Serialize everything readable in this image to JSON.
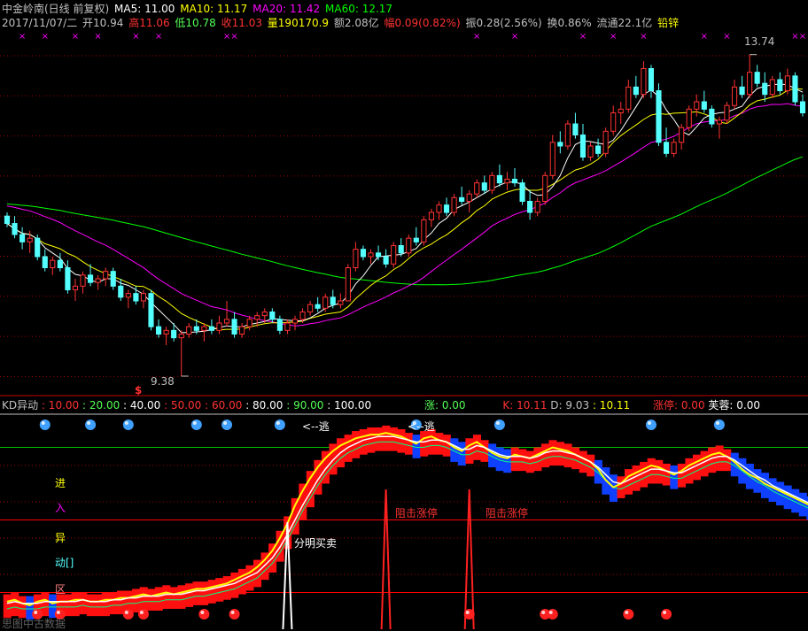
{
  "header": {
    "title": "中金岭南(日线 前复权)",
    "ma5_label": "MA5: 11.00",
    "ma10_label": "MA10: 11.17",
    "ma20_label": "MA20: 11.42",
    "ma60_label": "MA60: 12.17",
    "date": "2017/11/07/二",
    "open": "开10.94",
    "high": "高11.06",
    "low": "低10.78",
    "close": "收11.03",
    "volume": "量190170.9",
    "amount": "额2.08亿",
    "change": "幅0.09(0.82%)",
    "amplitude": "振0.28(2.56%)",
    "turnover": "换0.86%",
    "float": "流通22.1亿",
    "industry": "铅锌"
  },
  "indicator_header": {
    "name": "KD异动",
    "l10": ": 10.00",
    "l20": ": 20.00",
    "l40": ": 40.00",
    "l50": ": 50.00",
    "l60": ": 60.00",
    "l80": ": 80.00",
    "l90": ": 90.00",
    "l100": ": 100.00",
    "zhang": "涨: 0.00",
    "k": "K: 10.11",
    "d": "D: 9.03",
    "v": ": 10.11",
    "limit_up": "涨停: 0.00",
    "furong": "芙蓉: 0.00"
  },
  "annotations": {
    "high_label": "13.74",
    "low_label": "9.38",
    "escape1": "<--逃",
    "escape2": "<--逃",
    "resist1": "阻击涨停",
    "resist2": "阻击涨停",
    "trade": "分明买卖",
    "side_jin": "进",
    "side_ru": "入",
    "side_yi": "异",
    "side_dong": "动[]",
    "side_qu": "区",
    "dollar": "$",
    "footer": "思图中古数据"
  },
  "colors": {
    "up": "#ff3232",
    "down": "#54ffff",
    "ma5": "#ffffff",
    "ma10": "#ffff00",
    "ma20": "#ff00ff",
    "ma60": "#00ff00",
    "grid": "#a00000",
    "k_line": "#ffff00",
    "d_line": "#ffffff"
  },
  "chart_data": [
    {
      "type": "candlestick",
      "title": "中金岭南(日线 前复权)",
      "ylim": [
        9.2,
        14.0
      ],
      "annotations": {
        "max": 13.74,
        "min": 9.38
      },
      "candles": [
        [
          11.55,
          11.6,
          11.4,
          11.45
        ],
        [
          11.45,
          11.55,
          11.25,
          11.3
        ],
        [
          11.3,
          11.4,
          11.1,
          11.2
        ],
        [
          11.2,
          11.35,
          11.05,
          11.25
        ],
        [
          11.25,
          11.3,
          10.95,
          11.0
        ],
        [
          11.0,
          11.1,
          10.8,
          10.85
        ],
        [
          10.85,
          11.0,
          10.75,
          10.95
        ],
        [
          10.95,
          11.05,
          10.8,
          10.85
        ],
        [
          10.85,
          10.95,
          10.5,
          10.55
        ],
        [
          10.55,
          10.7,
          10.4,
          10.6
        ],
        [
          10.6,
          10.8,
          10.5,
          10.75
        ],
        [
          10.75,
          10.9,
          10.6,
          10.65
        ],
        [
          10.65,
          10.75,
          10.55,
          10.7
        ],
        [
          10.7,
          10.85,
          10.6,
          10.8
        ],
        [
          10.8,
          10.85,
          10.55,
          10.6
        ],
        [
          10.6,
          10.7,
          10.4,
          10.45
        ],
        [
          10.45,
          10.55,
          10.3,
          10.5
        ],
        [
          10.5,
          10.6,
          10.35,
          10.4
        ],
        [
          10.4,
          10.55,
          10.3,
          10.5
        ],
        [
          10.5,
          10.55,
          10.0,
          10.05
        ],
        [
          10.05,
          10.15,
          9.9,
          9.95
        ],
        [
          9.95,
          10.05,
          9.8,
          10.0
        ],
        [
          10.0,
          10.1,
          9.85,
          9.9
        ],
        [
          9.9,
          10.0,
          9.38,
          9.95
        ],
        [
          9.95,
          10.1,
          9.9,
          10.05
        ],
        [
          10.05,
          10.15,
          9.95,
          10.0
        ],
        [
          10.0,
          10.1,
          9.85,
          10.05
        ],
        [
          10.05,
          10.15,
          9.95,
          10.0
        ],
        [
          10.0,
          10.2,
          9.95,
          10.1
        ],
        [
          10.1,
          10.4,
          10.05,
          10.15
        ],
        [
          10.15,
          10.25,
          9.9,
          9.95
        ],
        [
          9.95,
          10.1,
          9.9,
          10.05
        ],
        [
          10.05,
          10.2,
          10.0,
          10.15
        ],
        [
          10.15,
          10.25,
          10.05,
          10.2
        ],
        [
          10.2,
          10.3,
          10.1,
          10.25
        ],
        [
          10.25,
          10.3,
          10.1,
          10.15
        ],
        [
          10.15,
          10.2,
          9.95,
          10.0
        ],
        [
          10.0,
          10.15,
          9.95,
          10.1
        ],
        [
          10.1,
          10.2,
          10.0,
          10.15
        ],
        [
          10.15,
          10.3,
          10.1,
          10.25
        ],
        [
          10.25,
          10.4,
          10.2,
          10.35
        ],
        [
          10.35,
          10.45,
          10.25,
          10.3
        ],
        [
          10.3,
          10.5,
          10.25,
          10.45
        ],
        [
          10.45,
          10.55,
          10.3,
          10.35
        ],
        [
          10.35,
          10.5,
          10.3,
          10.4
        ],
        [
          10.4,
          10.9,
          10.4,
          10.85
        ],
        [
          10.85,
          11.2,
          10.8,
          11.1
        ],
        [
          11.1,
          11.15,
          10.95,
          11.0
        ],
        [
          11.0,
          11.1,
          10.9,
          11.05
        ],
        [
          11.05,
          11.15,
          10.95,
          11.0
        ],
        [
          11.0,
          11.1,
          10.85,
          10.9
        ],
        [
          10.9,
          11.2,
          10.85,
          11.15
        ],
        [
          11.15,
          11.25,
          11.0,
          11.05
        ],
        [
          11.05,
          11.3,
          11.0,
          11.25
        ],
        [
          11.25,
          11.4,
          11.15,
          11.2
        ],
        [
          11.2,
          11.55,
          11.15,
          11.5
        ],
        [
          11.5,
          11.65,
          11.4,
          11.6
        ],
        [
          11.6,
          11.75,
          11.5,
          11.7
        ],
        [
          11.7,
          11.8,
          11.55,
          11.6
        ],
        [
          11.6,
          11.85,
          11.55,
          11.8
        ],
        [
          11.8,
          11.95,
          11.7,
          11.75
        ],
        [
          11.75,
          11.9,
          11.6,
          11.85
        ],
        [
          11.85,
          12.05,
          11.8,
          12.0
        ],
        [
          12.0,
          12.1,
          11.85,
          11.9
        ],
        [
          11.9,
          12.15,
          11.85,
          12.1
        ],
        [
          12.1,
          12.25,
          11.95,
          12.0
        ],
        [
          12.0,
          12.15,
          11.9,
          12.05
        ],
        [
          12.05,
          12.2,
          11.95,
          12.0
        ],
        [
          12.0,
          12.05,
          11.7,
          11.75
        ],
        [
          11.75,
          11.9,
          11.5,
          11.6
        ],
        [
          11.6,
          11.8,
          11.55,
          11.75
        ],
        [
          11.75,
          12.15,
          11.7,
          12.1
        ],
        [
          12.1,
          12.65,
          12.05,
          12.55
        ],
        [
          12.55,
          12.7,
          12.4,
          12.5
        ],
        [
          12.5,
          12.85,
          12.45,
          12.8
        ],
        [
          12.8,
          12.95,
          12.6,
          12.65
        ],
        [
          12.65,
          12.8,
          12.3,
          12.35
        ],
        [
          12.35,
          12.55,
          12.3,
          12.5
        ],
        [
          12.5,
          12.6,
          12.35,
          12.4
        ],
        [
          12.4,
          12.75,
          12.35,
          12.7
        ],
        [
          12.7,
          13.05,
          12.65,
          12.95
        ],
        [
          12.95,
          13.1,
          12.8,
          13.0
        ],
        [
          13.0,
          13.4,
          12.95,
          13.3
        ],
        [
          13.3,
          13.45,
          13.15,
          13.2
        ],
        [
          13.2,
          13.65,
          13.15,
          13.55
        ],
        [
          13.55,
          13.6,
          13.15,
          13.25
        ],
        [
          13.25,
          13.35,
          12.5,
          12.55
        ],
        [
          12.55,
          12.75,
          12.35,
          12.4
        ],
        [
          12.4,
          12.6,
          12.35,
          12.55
        ],
        [
          12.55,
          12.8,
          12.45,
          12.75
        ],
        [
          12.75,
          13.05,
          12.7,
          13.0
        ],
        [
          13.0,
          13.2,
          12.9,
          13.1
        ],
        [
          13.1,
          13.25,
          12.95,
          13.0
        ],
        [
          13.0,
          13.05,
          12.75,
          12.8
        ],
        [
          12.8,
          12.9,
          12.6,
          12.85
        ],
        [
          12.85,
          13.1,
          12.8,
          13.05
        ],
        [
          13.05,
          13.4,
          13.0,
          13.3
        ],
        [
          13.3,
          13.45,
          13.15,
          13.2
        ],
        [
          13.2,
          13.74,
          13.15,
          13.5
        ],
        [
          13.5,
          13.6,
          13.3,
          13.35
        ],
        [
          13.35,
          13.5,
          13.1,
          13.2
        ],
        [
          13.2,
          13.45,
          13.15,
          13.4
        ],
        [
          13.4,
          13.5,
          13.2,
          13.25
        ],
        [
          13.25,
          13.55,
          13.2,
          13.45
        ],
        [
          13.45,
          13.5,
          13.05,
          13.1
        ],
        [
          13.1,
          13.2,
          12.9,
          12.95
        ]
      ]
    },
    {
      "type": "line",
      "title": "KD异动",
      "ylim": [
        0,
        100
      ],
      "levels": [
        10,
        20,
        40,
        50,
        60,
        80,
        90,
        100
      ],
      "k": [
        5,
        6,
        4,
        3,
        5,
        6,
        4,
        5,
        5,
        6,
        6,
        5,
        5,
        6,
        6,
        7,
        7,
        8,
        9,
        8,
        9,
        10,
        9,
        10,
        11,
        12,
        12,
        13,
        14,
        15,
        17,
        19,
        21,
        24,
        28,
        33,
        40,
        48,
        58,
        66,
        73,
        79,
        84,
        88,
        91,
        93,
        95,
        96,
        97,
        97,
        98,
        97,
        96,
        94,
        92,
        95,
        96,
        94,
        93,
        90,
        88,
        91,
        93,
        90,
        87,
        85,
        84,
        86,
        85,
        84,
        86,
        88,
        90,
        89,
        88,
        86,
        84,
        82,
        78,
        72,
        68,
        70,
        74,
        76,
        78,
        80,
        79,
        77,
        75,
        77,
        80,
        82,
        84,
        86,
        87,
        85,
        82,
        78,
        75,
        73,
        70,
        68,
        66,
        64,
        62,
        60,
        58,
        56
      ],
      "d": [
        4,
        5,
        4,
        4,
        4,
        5,
        5,
        5,
        5,
        5,
        6,
        5,
        5,
        5,
        6,
        6,
        7,
        7,
        8,
        8,
        8,
        9,
        9,
        9,
        10,
        11,
        11,
        12,
        13,
        14,
        15,
        17,
        19,
        21,
        25,
        29,
        35,
        42,
        50,
        58,
        65,
        72,
        78,
        83,
        87,
        90,
        92,
        94,
        95,
        96,
        96,
        96,
        95,
        94,
        93,
        93,
        94,
        94,
        93,
        91,
        89,
        89,
        91,
        90,
        88,
        86,
        85,
        85,
        85,
        84,
        85,
        87,
        88,
        88,
        87,
        86,
        84,
        82,
        79,
        75,
        71,
        70,
        72,
        74,
        76,
        78,
        78,
        77,
        76,
        76,
        78,
        80,
        82,
        84,
        85,
        85,
        83,
        80,
        77,
        74,
        72,
        69,
        67,
        65,
        63,
        61,
        59,
        57
      ]
    }
  ]
}
